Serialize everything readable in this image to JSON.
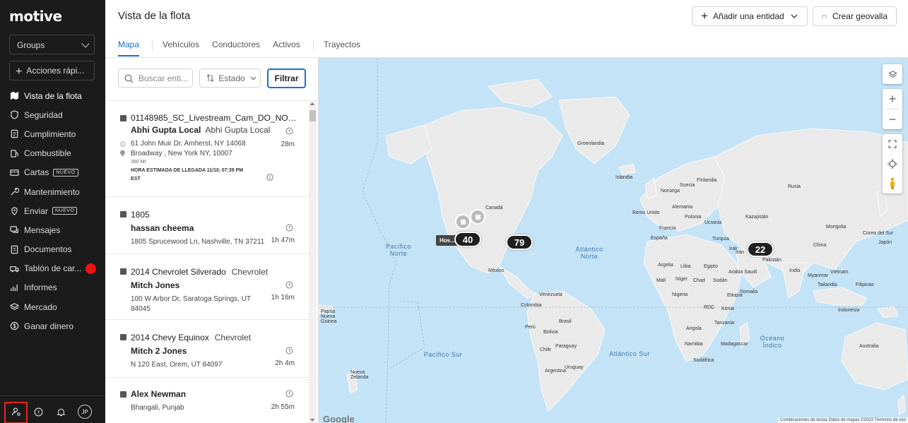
{
  "app": {
    "logo": "motive"
  },
  "sidebar": {
    "groups_label": "Groups",
    "quick_actions_label": "Acciones rápi...",
    "items": [
      {
        "label": "Vista de la flota",
        "icon": "map-icon",
        "active": true
      },
      {
        "label": "Seguridad",
        "icon": "shield-icon"
      },
      {
        "label": "Cumplimiento",
        "icon": "document-icon"
      },
      {
        "label": "Combustible",
        "icon": "fuel-icon"
      },
      {
        "label": "Cartas",
        "icon": "card-icon",
        "badge": "NUEVO"
      },
      {
        "label": "Mantenimiento",
        "icon": "wrench-icon"
      },
      {
        "label": "Enviar",
        "icon": "send-pin-icon",
        "badge": "NUEVO"
      },
      {
        "label": "Mensajes",
        "icon": "messages-icon"
      },
      {
        "label": "Documentos",
        "icon": "documents-icon"
      },
      {
        "label": "Tablón de car...",
        "icon": "truck-icon"
      },
      {
        "label": "Informes",
        "icon": "reports-icon"
      },
      {
        "label": "Mercado",
        "icon": "layers-icon"
      },
      {
        "label": "Ganar dinero",
        "icon": "dollar-icon"
      }
    ],
    "avatar_initials": "JP"
  },
  "header": {
    "title": "Vista de la flota",
    "add_entity_label": "Añadir una entidad",
    "create_geofence_label": "Crear geovalla",
    "tabs": [
      "Mapa",
      "Vehículos",
      "Conductores",
      "Activos",
      "Trayectos"
    ]
  },
  "panel": {
    "search_placeholder": "Buscar enti...",
    "status_label": "Estado",
    "filter_label": "Filtrar",
    "cards": [
      {
        "name": "01148985_SC_Livestream_Cam_DO_NOT_...",
        "driver": "Abhi Gupta Local",
        "driver_sub": "Abhi Gupta Local",
        "from": "61 John Muir Dr, Amherst, NY 14068",
        "to": "Broadway , New York NY, 10007",
        "miles": "380 MI",
        "time": "28m",
        "eta": "HORA ESTIMADA DE LLEGADA 11/10, 07:39 PM",
        "eta_tz": "EST"
      },
      {
        "name": "1805",
        "driver": "hassan cheema",
        "addr": "1805 Sprucewood Ln, Nashville, TN 37211",
        "time": "1h 47m"
      },
      {
        "name": "2014 Chevrolet Silverado",
        "brand": "Chevrolet",
        "driver": "Mitch Jones",
        "addr": "100 W Arbor Dr, Saratoga Springs, UT 84045",
        "time": "1h 16m"
      },
      {
        "name": "2014 Chevy Equinox",
        "brand": "Chevrolet",
        "driver": "Mitch 2 Jones",
        "addr": "N 120 East, Orem, UT 84097",
        "time": "2h 4m"
      },
      {
        "name": "Alex Newman",
        "driver": "Bhangali, Punjab",
        "time": "2h 55m"
      }
    ]
  },
  "map": {
    "clusters": [
      "40",
      "79",
      "22"
    ],
    "tooltip": "Hos...ri",
    "oceans": [
      "Pacífico Norte",
      "Atlántico Norte",
      "Pacífico Sur",
      "Atlántico Sur",
      "Océano Índico"
    ],
    "labels": [
      "Groenlandia",
      "Canadá",
      "México",
      "Venezuela",
      "Colombia",
      "Perú",
      "Brasil",
      "Bolivia",
      "Chile",
      "Argentina",
      "Papúa Nueva Guinea",
      "Nueva Zelanda",
      "Islandia",
      "Noruega",
      "Suecia",
      "Finlandia",
      "Rusia",
      "Kazajistán",
      "Mongolia",
      "China",
      "Turquía",
      "Irán",
      "Pakistán",
      "India",
      "Arabia Saudí",
      "Egipto",
      "Libia",
      "Argelia",
      "Malí",
      "Níger",
      "Chad",
      "Sudán",
      "Nigeria",
      "Etiopía",
      "Kenia",
      "Tanzania",
      "Angola",
      "Namibia",
      "Madagascar",
      "Sudáfrica",
      "Indonesia",
      "Australia",
      "Filipinas",
      "Tailandia",
      "Irak",
      "Francia",
      "España",
      "Ucrania",
      "Polonia",
      "Reino Unido",
      "Alemania",
      "Japón",
      "Corea del Sur",
      "Myanmar",
      "Vietnam",
      "RDC",
      "Somalia",
      "Uruguay",
      "Paraguay"
    ],
    "google": "Google",
    "attribution": "Combinaciones de teclas   Datos de mapas ©2023   Términos de uso"
  }
}
